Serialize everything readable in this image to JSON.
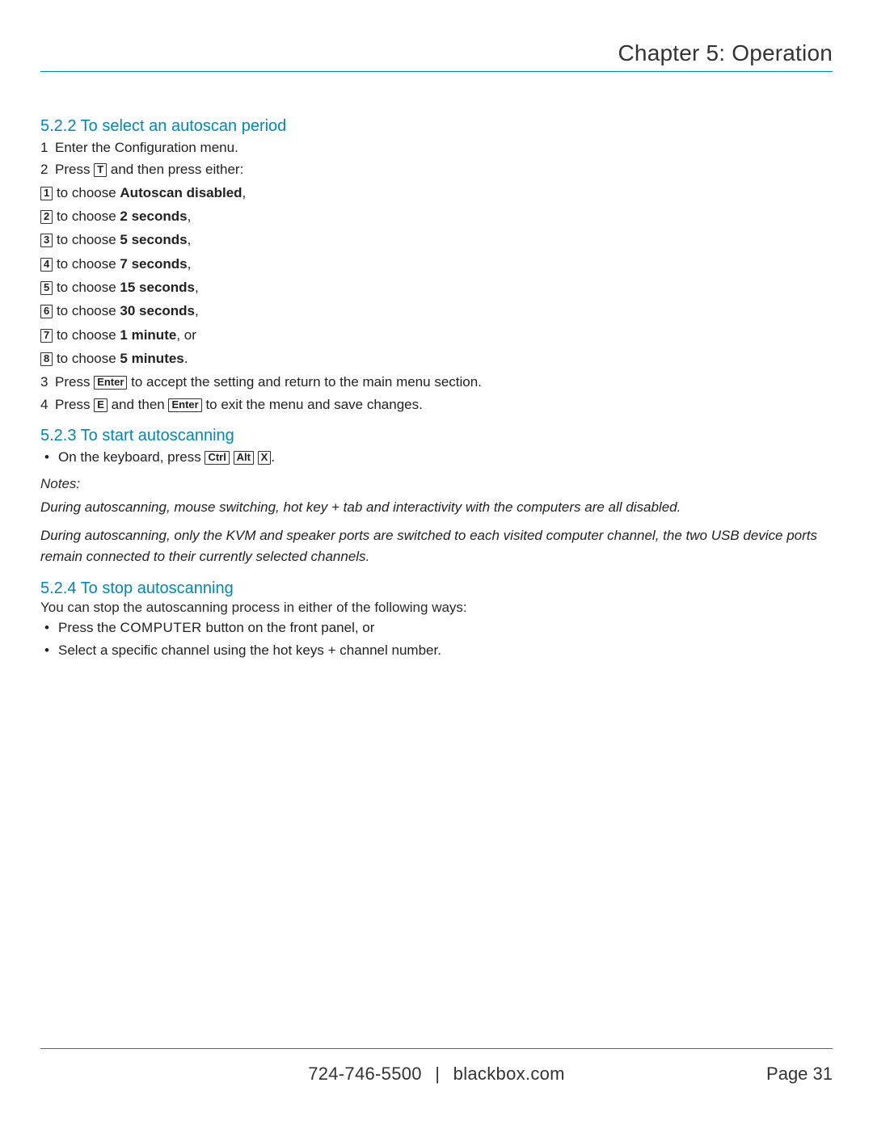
{
  "header": {
    "chapter_title": "Chapter 5: Operation"
  },
  "sec522": {
    "heading": "5.2.2 To select an autoscan period",
    "step1_num": "1",
    "step1_text": "Enter the Configuration menu.",
    "step2_num": "2",
    "step2_pre": "Press ",
    "step2_key": "T",
    "step2_post": " and then press either:",
    "opts": [
      {
        "key": "1",
        "pre": " to choose ",
        "bold": "Autoscan disabled",
        "post": ","
      },
      {
        "key": "2",
        "pre": " to choose ",
        "bold": "2 seconds",
        "post": ","
      },
      {
        "key": "3",
        "pre": " to choose ",
        "bold": "5 seconds",
        "post": ","
      },
      {
        "key": "4",
        "pre": " to choose ",
        "bold": "7 seconds",
        "post": ","
      },
      {
        "key": "5",
        "pre": " to choose ",
        "bold": "15 seconds",
        "post": ","
      },
      {
        "key": "6",
        "pre": " to choose ",
        "bold": "30 seconds",
        "post": ","
      },
      {
        "key": "7",
        "pre": " to choose ",
        "bold": "1 minute",
        "post": ", or"
      },
      {
        "key": "8",
        "pre": " to choose ",
        "bold": "5 minutes",
        "post": "."
      }
    ],
    "step3_num": "3",
    "step3_pre": "Press ",
    "step3_key": "Enter",
    "step3_post": " to accept the setting and return to the main menu section.",
    "step4_num": "4",
    "step4_pre": "Press ",
    "step4_key1": "E",
    "step4_mid": " and then ",
    "step4_key2": "Enter",
    "step4_post": " to exit the menu and save changes."
  },
  "sec523": {
    "heading": "5.2.3 To start autoscanning",
    "bullet_pre": "On the keyboard, press ",
    "key1": "Ctrl",
    "key2": "Alt",
    "key3": "X",
    "bullet_post": ".",
    "notes_label": "Notes:",
    "note1": "During autoscanning, mouse switching, hot key + tab and interactivity with the computers are all disabled.",
    "note2": "During autoscanning, only the KVM and speaker ports are switched to each visited computer channel, the two USB device ports remain connected to their currently selected channels."
  },
  "sec524": {
    "heading": "5.2.4 To stop autoscanning",
    "intro": "You can stop the autoscanning process in either of the following ways:",
    "b1_pre": "Press the ",
    "b1_sc": "COMPUTER",
    "b1_post": " button on the front panel, or",
    "b2": "Select a specific channel using the hot keys + channel number."
  },
  "footer": {
    "phone": "724-746-5500",
    "sep": "|",
    "site": "blackbox.com",
    "page_label": "Page 31"
  }
}
